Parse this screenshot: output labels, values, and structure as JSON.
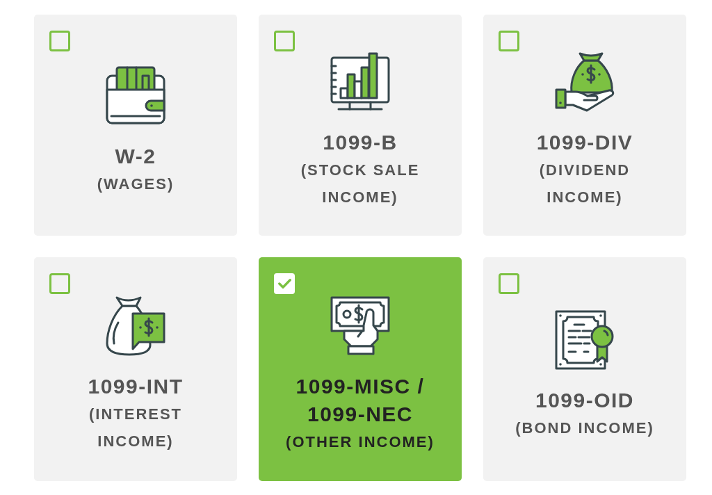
{
  "options": [
    {
      "title": "W-2",
      "subtitle": "(WAGES)",
      "selected": false
    },
    {
      "title": "1099-B",
      "subtitle": "(STOCK SALE INCOME)",
      "selected": false
    },
    {
      "title": "1099-DIV",
      "subtitle": "(DIVIDEND INCOME)",
      "selected": false
    },
    {
      "title": "1099-INT",
      "subtitle": "(INTEREST INCOME)",
      "selected": false
    },
    {
      "title": "1099-MISC / 1099-NEC",
      "subtitle": "(OTHER INCOME)",
      "selected": true
    },
    {
      "title": "1099-OID",
      "subtitle": "(BOND INCOME)",
      "selected": false
    }
  ]
}
